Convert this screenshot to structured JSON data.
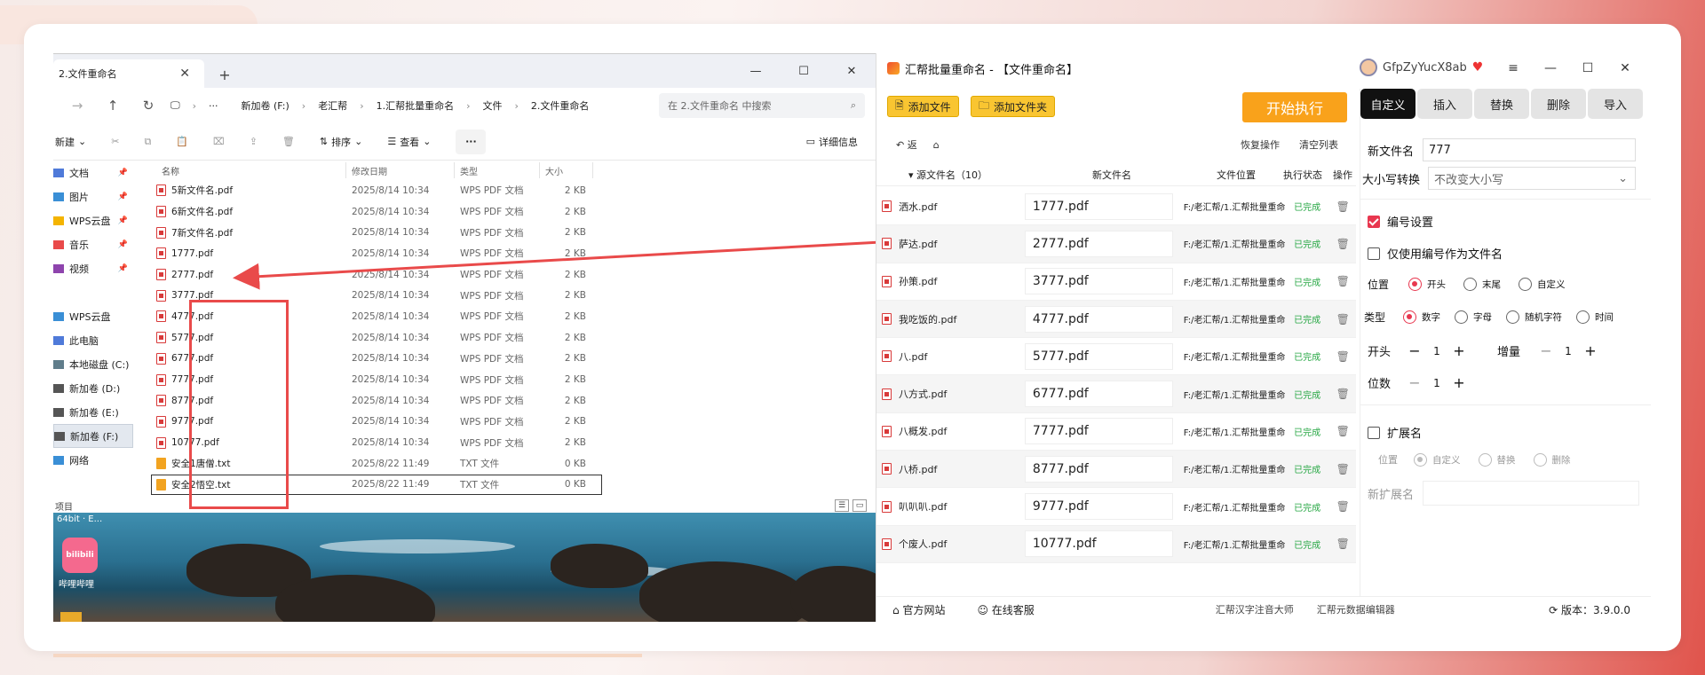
{
  "explorer": {
    "tab_title": "2.文件重命名",
    "tab_close": "✕",
    "tab_add": "+",
    "window_buttons": [
      "—",
      "☐",
      "✕"
    ],
    "breadcrumb": [
      "新加卷 (F:)",
      "老汇帮",
      "1.汇帮批量重命名",
      "文件",
      "2.文件重命名"
    ],
    "breadcrumb_more": "···",
    "search_placeholder": "在 2.文件重命名 中搜索",
    "commands": {
      "new": "新建",
      "sort": "排序",
      "view": "查看",
      "more": "···",
      "details": "详细信息"
    },
    "nav_items": [
      {
        "label": "文档",
        "pinned": true
      },
      {
        "label": "图片",
        "pinned": true
      },
      {
        "label": "WPS云盘",
        "pinned": true
      },
      {
        "label": "音乐",
        "pinned": true
      },
      {
        "label": "视频",
        "pinned": true
      },
      {
        "label": "",
        "pinned": false
      },
      {
        "label": "WPS云盘",
        "pinned": false
      },
      {
        "label": "此电脑",
        "pinned": false
      },
      {
        "label": "本地磁盘 (C:)",
        "pinned": false
      },
      {
        "label": "新加卷 (D:)",
        "pinned": false
      },
      {
        "label": "新加卷 (E:)",
        "pinned": false
      },
      {
        "label": "新加卷 (F:)",
        "pinned": false
      },
      {
        "label": "网络",
        "pinned": false
      }
    ],
    "columns": {
      "name": "名称",
      "date": "修改日期",
      "type": "类型",
      "size": "大小"
    },
    "files": [
      {
        "name": "5新文件名.pdf",
        "date": "2025/8/14 10:34",
        "type": "WPS PDF 文档",
        "size": "2 KB",
        "kind": "pdf"
      },
      {
        "name": "6新文件名.pdf",
        "date": "2025/8/14 10:34",
        "type": "WPS PDF 文档",
        "size": "2 KB",
        "kind": "pdf"
      },
      {
        "name": "7新文件名.pdf",
        "date": "2025/8/14 10:34",
        "type": "WPS PDF 文档",
        "size": "2 KB",
        "kind": "pdf"
      },
      {
        "name": "1777.pdf",
        "date": "2025/8/14 10:34",
        "type": "WPS PDF 文档",
        "size": "2 KB",
        "kind": "pdf"
      },
      {
        "name": "2777.pdf",
        "date": "2025/8/14 10:34",
        "type": "WPS PDF 文档",
        "size": "2 KB",
        "kind": "pdf"
      },
      {
        "name": "3777.pdf",
        "date": "2025/8/14 10:34",
        "type": "WPS PDF 文档",
        "size": "2 KB",
        "kind": "pdf"
      },
      {
        "name": "4777.pdf",
        "date": "2025/8/14 10:34",
        "type": "WPS PDF 文档",
        "size": "2 KB",
        "kind": "pdf"
      },
      {
        "name": "5777.pdf",
        "date": "2025/8/14 10:34",
        "type": "WPS PDF 文档",
        "size": "2 KB",
        "kind": "pdf"
      },
      {
        "name": "6777.pdf",
        "date": "2025/8/14 10:34",
        "type": "WPS PDF 文档",
        "size": "2 KB",
        "kind": "pdf"
      },
      {
        "name": "7777.pdf",
        "date": "2025/8/14 10:34",
        "type": "WPS PDF 文档",
        "size": "2 KB",
        "kind": "pdf"
      },
      {
        "name": "8777.pdf",
        "date": "2025/8/14 10:34",
        "type": "WPS PDF 文档",
        "size": "2 KB",
        "kind": "pdf"
      },
      {
        "name": "9777.pdf",
        "date": "2025/8/14 10:34",
        "type": "WPS PDF 文档",
        "size": "2 KB",
        "kind": "pdf"
      },
      {
        "name": "10777.pdf",
        "date": "2025/8/14 10:34",
        "type": "WPS PDF 文档",
        "size": "2 KB",
        "kind": "pdf"
      },
      {
        "name": "安全1唐僧.txt",
        "date": "2025/8/22 11:49",
        "type": "TXT 文件",
        "size": "0 KB",
        "kind": "txt"
      },
      {
        "name": "安全2悟空.txt",
        "date": "2025/8/22 11:49",
        "type": "TXT 文件",
        "size": "0 KB",
        "kind": "txt"
      }
    ],
    "status": "项目"
  },
  "desktop": {
    "top_label": "64bit · E...",
    "app_icon_text": "bilibili",
    "app_label": "哔哩哔哩"
  },
  "app": {
    "title": "汇帮批量重命名 - 【文件重命名】",
    "username": "GfpZyYucX8ab",
    "window_buttons": [
      "≡",
      "—",
      "☐",
      "✕"
    ],
    "add_file": "添加文件",
    "add_folder": "添加文件夹",
    "start": "开始执行",
    "back": "返",
    "restore": "恢复操作",
    "clear": "清空列表",
    "table_headers": {
      "source": "▾ 源文件名（10）",
      "new": "新文件名",
      "location": "文件位置",
      "status": "执行状态",
      "op": "操作"
    },
    "rows": [
      {
        "src": "洒水.pdf",
        "new": "1777.pdf",
        "loc": "F:/老汇帮/1.汇帮批量重命名",
        "status": "已完成"
      },
      {
        "src": "萨达.pdf",
        "new": "2777.pdf",
        "loc": "F:/老汇帮/1.汇帮批量重命名",
        "status": "已完成"
      },
      {
        "src": "孙策.pdf",
        "new": "3777.pdf",
        "loc": "F:/老汇帮/1.汇帮批量重命名",
        "status": "已完成"
      },
      {
        "src": "我吃饭的.pdf",
        "new": "4777.pdf",
        "loc": "F:/老汇帮/1.汇帮批量重命名",
        "status": "已完成"
      },
      {
        "src": "八.pdf",
        "new": "5777.pdf",
        "loc": "F:/老汇帮/1.汇帮批量重命名",
        "status": "已完成"
      },
      {
        "src": "八方式.pdf",
        "new": "6777.pdf",
        "loc": "F:/老汇帮/1.汇帮批量重命名",
        "status": "已完成"
      },
      {
        "src": "八概发.pdf",
        "new": "7777.pdf",
        "loc": "F:/老汇帮/1.汇帮批量重命名",
        "status": "已完成"
      },
      {
        "src": "八桥.pdf",
        "new": "8777.pdf",
        "loc": "F:/老汇帮/1.汇帮批量重命名",
        "status": "已完成"
      },
      {
        "src": "叭叭叭.pdf",
        "new": "9777.pdf",
        "loc": "F:/老汇帮/1.汇帮批量重命名",
        "status": "已完成"
      },
      {
        "src": "个废人.pdf",
        "new": "10777.pdf",
        "loc": "F:/老汇帮/1.汇帮批量重命名",
        "status": "已完成"
      }
    ],
    "footer": {
      "website": "官方网站",
      "service": "在线客服",
      "link1": "汇帮汉字注音大师",
      "link2": "汇帮元数据编辑器",
      "version": "版本：3.9.0.0"
    },
    "panel": {
      "tabs": [
        "自定义",
        "插入",
        "替换",
        "删除",
        "导入"
      ],
      "new_name_label": "新文件名",
      "new_name_value": "777",
      "case_label": "大小写转换",
      "case_value": "不改变大小写",
      "numbering_label": "编号设置",
      "use_number_label": "仅使用编号作为文件名",
      "position_label": "位置",
      "position_options": [
        "开头",
        "末尾",
        "自定义"
      ],
      "type_label": "类型",
      "type_options": [
        "数字",
        "字母",
        "随机字符",
        "时间"
      ],
      "start_label": "开头",
      "start_value": "1",
      "increment_label": "增量",
      "increment_value": "1",
      "digits_label": "位数",
      "digits_value": "1",
      "ext_label": "扩展名",
      "ext_position_label": "位置",
      "ext_options": [
        "自定义",
        "替换",
        "删除"
      ],
      "new_ext_label": "新扩展名"
    }
  }
}
